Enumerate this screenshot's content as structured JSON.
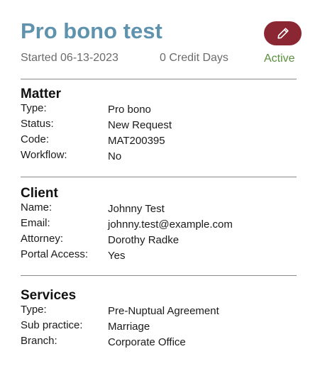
{
  "header": {
    "title": "Pro bono test",
    "started": "Started 06-13-2023",
    "credit_days": "0 Credit Days",
    "status": "Active",
    "edit_icon": "pencil-icon",
    "accent_color": "#8b2633",
    "title_color": "#5f93ad",
    "status_color": "#5a8f3c"
  },
  "sections": [
    {
      "title": "Matter",
      "rows": [
        {
          "label": "Type:",
          "value": "Pro bono"
        },
        {
          "label": "Status:",
          "value": "New Request"
        },
        {
          "label": "Code:",
          "value": "MAT200395"
        },
        {
          "label": "Workflow:",
          "value": "No"
        }
      ]
    },
    {
      "title": "Client",
      "rows": [
        {
          "label": "Name:",
          "value": "Johnny Test"
        },
        {
          "label": "Email:",
          "value": "johnny.test@example.com"
        },
        {
          "label": "Attorney:",
          "value": "Dorothy Radke"
        },
        {
          "label": "Portal Access:",
          "value": "Yes"
        }
      ]
    },
    {
      "title": "Services",
      "rows": [
        {
          "label": "Type:",
          "value": "Pre-Nuptual Agreement"
        },
        {
          "label": "Sub practice:",
          "value": "Marriage"
        },
        {
          "label": "Branch:",
          "value": "Corporate Office"
        }
      ]
    }
  ]
}
